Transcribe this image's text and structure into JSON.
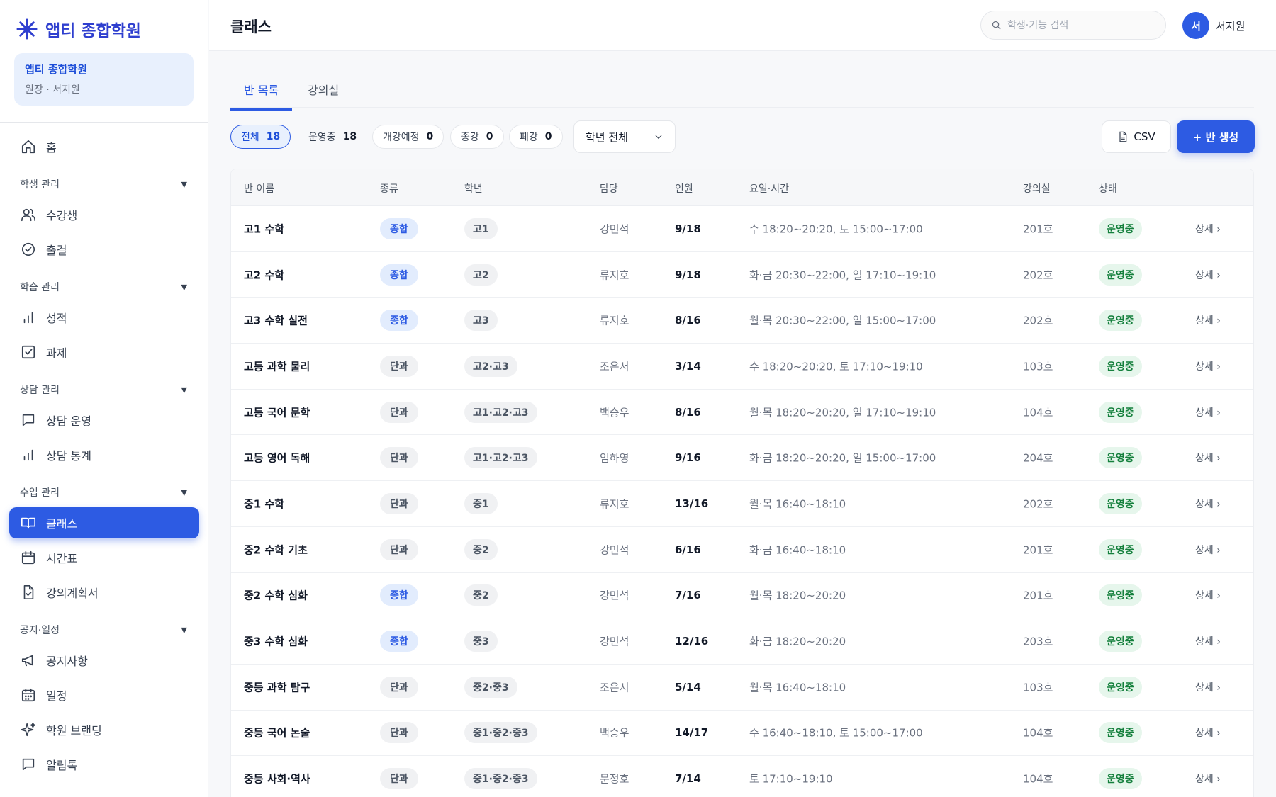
{
  "brand": {
    "name": "앱티 종합학원"
  },
  "org_card": {
    "name": "앱티 종합학원",
    "role": "원장 · 서지원"
  },
  "sidebar": {
    "home": "홈",
    "sections": [
      {
        "title": "학생 관리",
        "items": [
          "수강생",
          "출결"
        ]
      },
      {
        "title": "학습 관리",
        "items": [
          "성적",
          "과제"
        ]
      },
      {
        "title": "상담 관리",
        "items": [
          "상담 운영",
          "상담 통계"
        ]
      },
      {
        "title": "수업 관리",
        "items": [
          "클래스",
          "시간표",
          "강의계획서"
        ]
      },
      {
        "title": "공지·일정",
        "items": [
          "공지사항",
          "일정",
          "학원 브랜딩",
          "알림톡"
        ]
      }
    ],
    "active_item": "클래스"
  },
  "header": {
    "title": "클래스",
    "search_placeholder": "학생·기능 검색",
    "avatar_initial": "서",
    "user_name": "서지원"
  },
  "tabs": [
    "반 목록",
    "강의실"
  ],
  "filters": [
    {
      "label": "전체",
      "count": "18"
    },
    {
      "label": "운영중",
      "count": "18"
    },
    {
      "label": "개강예정",
      "count": "0"
    },
    {
      "label": "종강",
      "count": "0"
    },
    {
      "label": "폐강",
      "count": "0"
    }
  ],
  "grade_select": "학년 전체",
  "csv_label": "CSV",
  "create_label": "+ 반 생성",
  "table": {
    "headers": [
      "반 이름",
      "종류",
      "학년",
      "담당",
      "인원",
      "요일·시간",
      "강의실",
      "상태"
    ],
    "detail_label": "상세 ›",
    "rows": [
      {
        "name": "고1 수학",
        "type": "종합",
        "grade": "고1",
        "teacher": "강민석",
        "capacity": "9/18",
        "time": "수 18:20~20:20, 토 15:00~17:00",
        "room": "201호",
        "status": "운영중"
      },
      {
        "name": "고2 수학",
        "type": "종합",
        "grade": "고2",
        "teacher": "류지호",
        "capacity": "9/18",
        "time": "화·금 20:30~22:00, 일 17:10~19:10",
        "room": "202호",
        "status": "운영중"
      },
      {
        "name": "고3 수학 실전",
        "type": "종합",
        "grade": "고3",
        "teacher": "류지호",
        "capacity": "8/16",
        "time": "월·목 20:30~22:00, 일 15:00~17:00",
        "room": "202호",
        "status": "운영중"
      },
      {
        "name": "고등 과학 물리",
        "type": "단과",
        "grade": "고2·고3",
        "teacher": "조은서",
        "capacity": "3/14",
        "time": "수 18:20~20:20, 토 17:10~19:10",
        "room": "103호",
        "status": "운영중"
      },
      {
        "name": "고등 국어 문학",
        "type": "단과",
        "grade": "고1·고2·고3",
        "teacher": "백승우",
        "capacity": "8/16",
        "time": "월·목 18:20~20:20, 일 17:10~19:10",
        "room": "104호",
        "status": "운영중"
      },
      {
        "name": "고등 영어 독해",
        "type": "단과",
        "grade": "고1·고2·고3",
        "teacher": "임하영",
        "capacity": "9/16",
        "time": "화·금 18:20~20:20, 일 15:00~17:00",
        "room": "204호",
        "status": "운영중"
      },
      {
        "name": "중1 수학",
        "type": "단과",
        "grade": "중1",
        "teacher": "류지호",
        "capacity": "13/16",
        "time": "월·목 16:40~18:10",
        "room": "202호",
        "status": "운영중"
      },
      {
        "name": "중2 수학 기초",
        "type": "단과",
        "grade": "중2",
        "teacher": "강민석",
        "capacity": "6/16",
        "time": "화·금 16:40~18:10",
        "room": "201호",
        "status": "운영중"
      },
      {
        "name": "중2 수학 심화",
        "type": "종합",
        "grade": "중2",
        "teacher": "강민석",
        "capacity": "7/16",
        "time": "월·목 18:20~20:20",
        "room": "201호",
        "status": "운영중"
      },
      {
        "name": "중3 수학 심화",
        "type": "종합",
        "grade": "중3",
        "teacher": "강민석",
        "capacity": "12/16",
        "time": "화·금 18:20~20:20",
        "room": "203호",
        "status": "운영중"
      },
      {
        "name": "중등 과학 탐구",
        "type": "단과",
        "grade": "중2·중3",
        "teacher": "조은서",
        "capacity": "5/14",
        "time": "월·목 16:40~18:10",
        "room": "103호",
        "status": "운영중"
      },
      {
        "name": "중등 국어 논술",
        "type": "단과",
        "grade": "중1·중2·중3",
        "teacher": "백승우",
        "capacity": "14/17",
        "time": "수 16:40~18:10, 토 15:00~17:00",
        "room": "104호",
        "status": "운영중"
      },
      {
        "name": "중등 사회·역사",
        "type": "단과",
        "grade": "중1·중2·중3",
        "teacher": "문정호",
        "capacity": "7/14",
        "time": "토 17:10~19:10",
        "room": "104호",
        "status": "운영중"
      }
    ]
  },
  "colors": {
    "accent": "#2d5be3",
    "status_green": "#15803d"
  }
}
